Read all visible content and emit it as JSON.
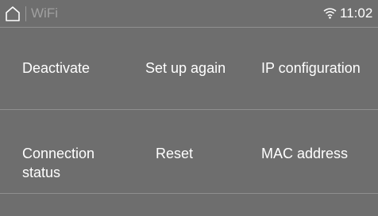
{
  "header": {
    "title": "WiFi",
    "time": "11:02"
  },
  "icons": {
    "home": "home-icon",
    "wifi": "wifi-signal-icon"
  },
  "menu": {
    "row1": [
      "Deactivate",
      "Set up again",
      "IP configuration"
    ],
    "row2": [
      "Connection status",
      "Reset",
      "MAC address"
    ]
  },
  "colors": {
    "background": "#6e6e6e",
    "title_muted": "#a0a0a0",
    "divider": "#8f8f8f",
    "text": "#ffffff"
  }
}
